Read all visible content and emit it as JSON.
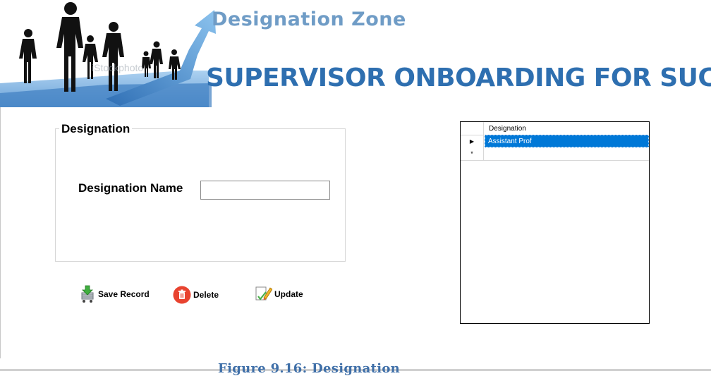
{
  "banner": {
    "zone_title": "Designation Zone",
    "main_title": "SUPERVISOR ONBOARDING FOR SUCCESS",
    "watermark": "iStockphoto",
    "colors": {
      "zone_title": "#6f9cc6",
      "main_title": "#2e6fb0",
      "arrow": "#4a90d0"
    }
  },
  "form": {
    "group_title": "Designation",
    "designation_label": "Designation Name",
    "designation_value": "",
    "designation_placeholder": ""
  },
  "actions": {
    "save_label": "Save Record",
    "delete_label": "Delete",
    "update_label": "Update"
  },
  "grid": {
    "column_header": "Designation",
    "rows": [
      {
        "designation": "Assistant Prof",
        "selected": true
      }
    ],
    "new_row_marker": "*",
    "current_row_marker": "▶",
    "selection_color": "#0078d7"
  },
  "caption": "Figure 9.16: Designation"
}
